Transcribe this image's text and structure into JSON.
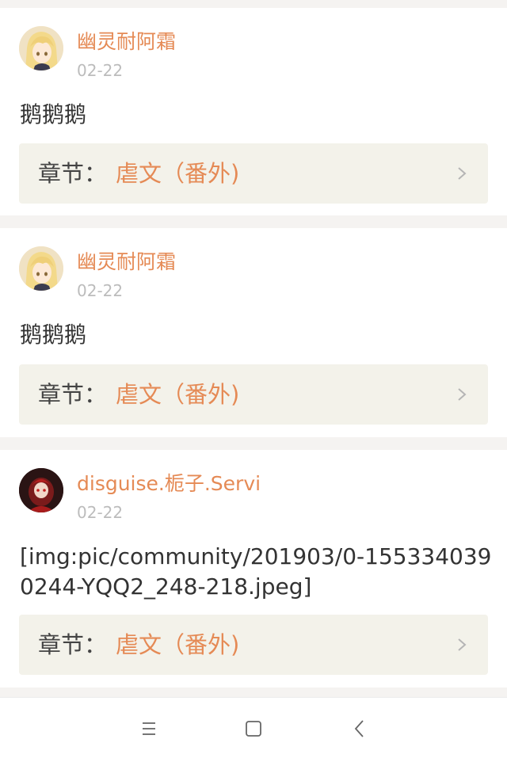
{
  "posts": [
    {
      "username": "幽灵耐阿霜",
      "date": "02-22",
      "content": "鹅鹅鹅",
      "avatar": "anime-girl-avatar",
      "chapter_label": "章节：",
      "chapter_title": "虐文（番外)"
    },
    {
      "username": "幽灵耐阿霜",
      "date": "02-22",
      "content": "鹅鹅鹅",
      "avatar": "anime-girl-avatar",
      "chapter_label": "章节：",
      "chapter_title": "虐文（番外)"
    },
    {
      "username": "disguise.栀子.Servi",
      "date": "02-22",
      "content": "[img:pic/community/201903/0-1553340390244-YQQ2_248-218.jpeg]",
      "avatar": "red-character-avatar",
      "chapter_label": "章节：",
      "chapter_title": "虐文（番外)"
    }
  ],
  "colors": {
    "accent": "#e58a55",
    "date": "#bcbcbc",
    "text": "#333333",
    "chapter_bg": "#f3f2ea",
    "page_bg": "#f5f3f1"
  },
  "navbar": {
    "items": [
      "menu-icon",
      "home-icon",
      "back-icon"
    ]
  }
}
